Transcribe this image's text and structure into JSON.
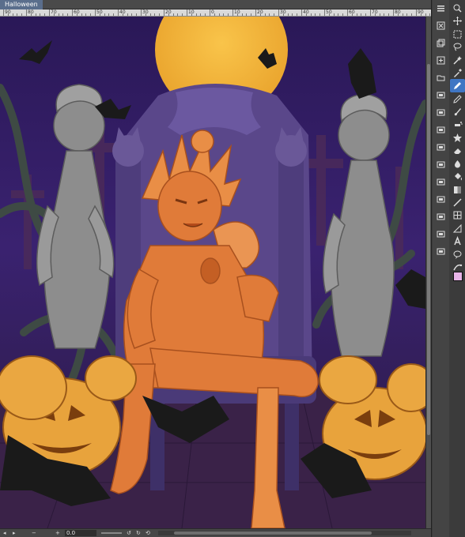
{
  "document": {
    "tab_title": "Halloween"
  },
  "ruler": {
    "labels": [
      "90",
      "80",
      "70",
      "60",
      "50",
      "40",
      "30",
      "20",
      "10",
      "0",
      "10",
      "20",
      "30",
      "40",
      "50",
      "60",
      "70",
      "80",
      "90"
    ]
  },
  "statusbar": {
    "prev_label": "◂",
    "next_label": "▸",
    "minus_label": "−",
    "plus_label": "+",
    "zoom_value": "0.0",
    "rotate_left_label": "↺",
    "rotate_right_label": "↻",
    "reset_label": "⟲",
    "rotate_value": "0"
  },
  "toolbox": {
    "selected_tool": "pen-tool",
    "primary_color": "#e8b4e8",
    "secondary_color": "#ffffff",
    "tools_a": [
      "menu-icon",
      "delete-layer-icon",
      "layer-copy-icon",
      "new-layer-icon",
      "new-folder-icon",
      "layer-icon",
      "layer-icon",
      "layer-icon",
      "layer-icon",
      "layer-icon",
      "layer-icon",
      "layer-icon",
      "layer-icon",
      "layer-icon",
      "layer-icon"
    ],
    "tools_b": [
      "zoom-icon",
      "move-icon",
      "select-icon",
      "lasso-icon",
      "wand-icon",
      "eyedropper-icon",
      "pen-tool",
      "pencil-icon",
      "brush-icon",
      "airbrush-icon",
      "decoration-icon",
      "eraser-icon",
      "blend-icon",
      "fill-icon",
      "gradient-icon",
      "shape-icon",
      "frame-icon",
      "ruler-icon",
      "text-icon",
      "balloon-icon",
      "correction-icon"
    ]
  },
  "accent_colors": {
    "sky": "#2f1c5c",
    "moon": "#f4b63c",
    "orange_character": "#e07b39",
    "statue_gray": "#8b8b8b",
    "throne_purple": "#5c4a8c",
    "pumpkin": "#e8a33c",
    "bat": "#1a1a1a",
    "ui_active": "#3f76c4"
  }
}
